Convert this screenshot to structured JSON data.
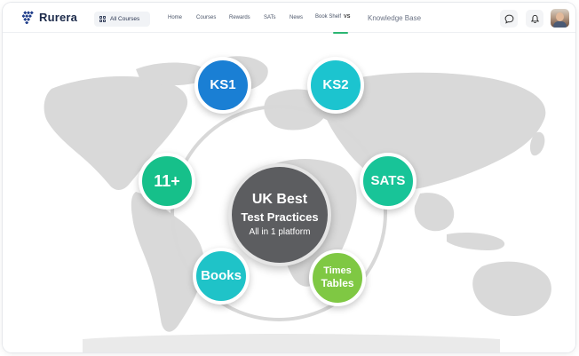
{
  "brand": {
    "name": "Rurera"
  },
  "header": {
    "all_courses": "All Courses",
    "nav": [
      "Home",
      "Courses",
      "Rewards",
      "SATs",
      "News"
    ],
    "book_shelf": "Book Shelf",
    "book_shelf_badge": "VS",
    "knowledge_base": "Knowledge Base"
  },
  "hero": {
    "center": {
      "line1": "UK Best",
      "line2": "Test Practices",
      "line3": "All in 1 platform"
    },
    "nodes": {
      "ks1": "KS1",
      "ks2": "KS2",
      "elevenplus": "11+",
      "sats": "SATS",
      "books": "Books",
      "times_line1": "Times",
      "times_line2": "Tables"
    }
  },
  "colors": {
    "ks1": "#1a7fd4",
    "ks2": "#1cc4cf",
    "elevenplus": "#16c08a",
    "sats": "#18c498",
    "books": "#1fc3c8",
    "times_tables": "#7fc843",
    "center": "#5c5d60",
    "nav_active": "#2bb673"
  },
  "icons": {
    "logo": "rurera-logo-icon",
    "all_courses": "grid-icon",
    "chat": "chat-icon",
    "notifications": "bell-icon",
    "avatar": "user-avatar"
  }
}
